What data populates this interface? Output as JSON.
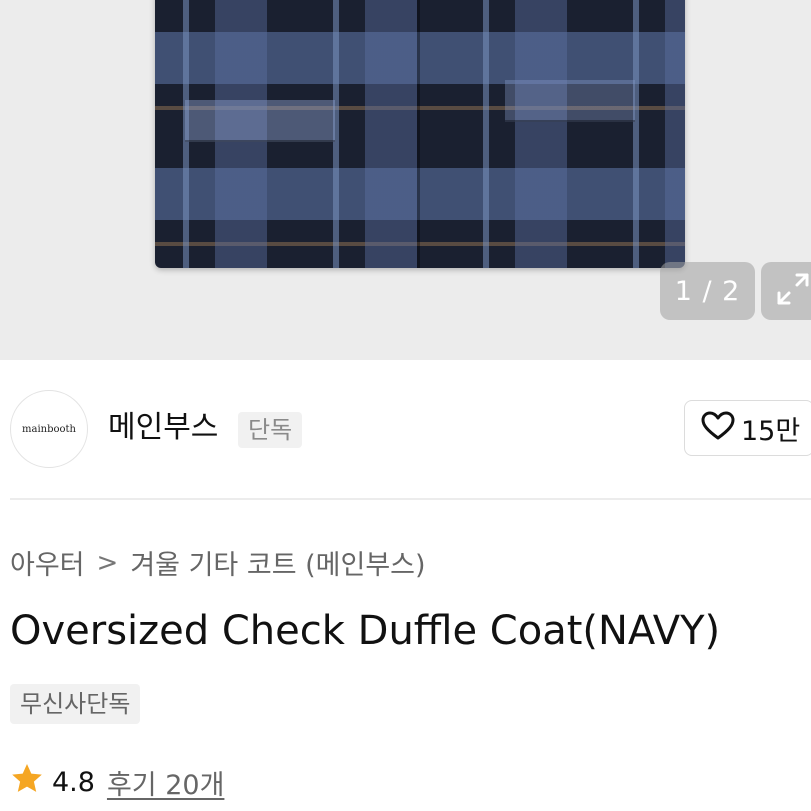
{
  "gallery": {
    "counter": "1 / 2",
    "expand_icon": "expand-icon"
  },
  "brand": {
    "logo_text": "mainbooth",
    "name": "메인부스",
    "badge": "단독"
  },
  "like": {
    "icon": "heart-icon",
    "count": "15만"
  },
  "breadcrumb": {
    "items": [
      "아우터",
      "겨울 기타 코트 (메인부스)"
    ],
    "separator": ">"
  },
  "product": {
    "title": "Oversized Check Duffle Coat(NAVY)",
    "tag": "무신사단독"
  },
  "rating": {
    "icon": "star-icon",
    "value": "4.8",
    "reviews": "후기 20개",
    "star_color": "#f5a623"
  }
}
